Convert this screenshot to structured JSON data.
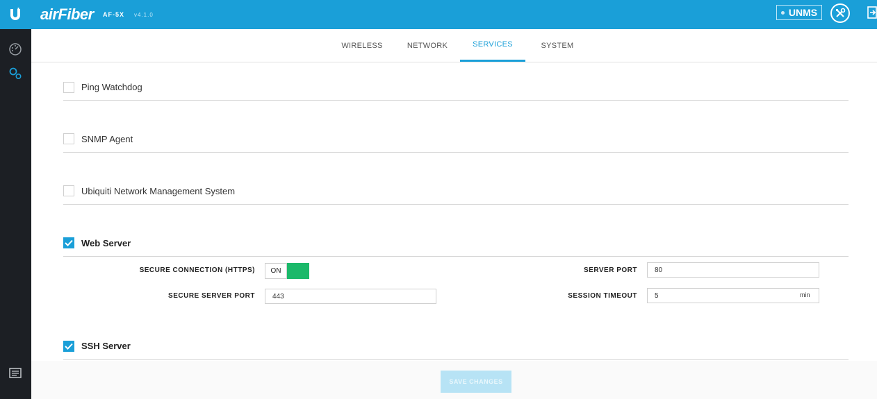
{
  "header": {
    "logo_icon": "ubiquiti-u-logo",
    "brand": "airFiber",
    "model": "AF-5X",
    "version": "v4.1.0",
    "unms_label": "UNMS",
    "tools_icon": "tools-icon",
    "logout_icon": "logout-icon",
    "color": "#1a9fd8"
  },
  "sidebar": {
    "items": [
      {
        "icon": "dashboard-gauge-icon"
      },
      {
        "icon": "settings-gears-icon"
      },
      {
        "icon": "log-icon"
      }
    ]
  },
  "tabs": [
    {
      "label": "WIRELESS",
      "active": false
    },
    {
      "label": "NETWORK",
      "active": false
    },
    {
      "label": "SERVICES",
      "active": true
    },
    {
      "label": "SYSTEM",
      "active": false
    }
  ],
  "services": {
    "ping_watchdog": {
      "label": "Ping Watchdog",
      "checked": false
    },
    "snmp_agent": {
      "label": "SNMP Agent",
      "checked": false
    },
    "unms": {
      "label": "Ubiquiti Network Management System",
      "checked": false
    },
    "web_server": {
      "label": "Web Server",
      "checked": true,
      "secure_connection_label": "SECURE CONNECTION (HTTPS)",
      "secure_connection_state": "ON",
      "server_port_label": "SERVER PORT",
      "server_port_value": "80",
      "secure_server_port_label": "SECURE SERVER PORT",
      "secure_server_port_value": "443",
      "session_timeout_label": "SESSION TIMEOUT",
      "session_timeout_value": "5",
      "session_timeout_unit": "min"
    },
    "ssh_server": {
      "label": "SSH Server",
      "checked": true
    }
  },
  "footer": {
    "save_label": "SAVE CHANGES"
  },
  "colors": {
    "accent": "#1a9fd8",
    "toggle_on": "#1bb96a",
    "sidebar": "#1c1f24"
  }
}
